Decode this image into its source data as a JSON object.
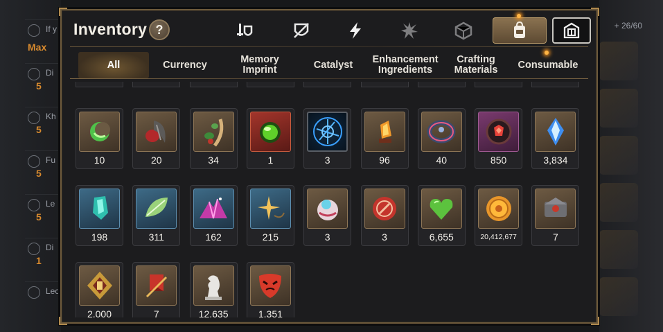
{
  "background": {
    "left_rows": [
      {
        "name": "If y"
      },
      {
        "name": "Di",
        "level": "5"
      },
      {
        "name": "Kh",
        "level": "5"
      },
      {
        "name": "Fu",
        "level": "5"
      },
      {
        "name": "Le",
        "level": "5"
      },
      {
        "name": "Di",
        "level": "1"
      },
      {
        "name": "Leo"
      }
    ],
    "max_label": "Max",
    "right_count": "+ 26/60"
  },
  "panel": {
    "title": "Inventory",
    "help_label": "?",
    "category_icons": [
      {
        "name": "equipment-icon",
        "active": false
      },
      {
        "name": "broken-shield-icon",
        "active": false
      },
      {
        "name": "lightning-icon",
        "active": false
      },
      {
        "name": "burst-icon",
        "active": false
      },
      {
        "name": "cube-icon",
        "active": false
      },
      {
        "name": "backpack-icon",
        "active": true
      },
      {
        "name": "storage-icon",
        "active": false
      }
    ],
    "tabs": [
      {
        "label": "All",
        "active": true
      },
      {
        "label": "Currency",
        "active": false
      },
      {
        "label": "Memory Imprint",
        "active": false
      },
      {
        "label": "Catalyst",
        "active": false
      },
      {
        "label": "Enhancement Ingredients",
        "active": false
      },
      {
        "label": "Crafting Materials",
        "active": false
      },
      {
        "label": "Consumable",
        "active": false
      }
    ],
    "items": [
      {
        "icon": "green-crescent-icon",
        "rarity": "brown",
        "qty": "10"
      },
      {
        "icon": "red-claw-icon",
        "rarity": "brown",
        "qty": "20"
      },
      {
        "icon": "leaf-sprig-icon",
        "rarity": "brown",
        "qty": "34"
      },
      {
        "icon": "green-orb-icon",
        "rarity": "red",
        "qty": "1"
      },
      {
        "icon": "blue-rune-icon",
        "rarity": "round",
        "qty": "3"
      },
      {
        "icon": "flame-crystal-icon",
        "rarity": "brown",
        "qty": "96"
      },
      {
        "icon": "bracelet-icon",
        "rarity": "brown",
        "qty": "40"
      },
      {
        "icon": "red-gem-icon",
        "rarity": "purple",
        "qty": "850"
      },
      {
        "icon": "blue-gem-icon",
        "rarity": "brown",
        "qty": "3,834"
      },
      {
        "icon": "cyan-crystal-icon",
        "rarity": "blue",
        "qty": "198"
      },
      {
        "icon": "green-leaf-icon",
        "rarity": "blue",
        "qty": "311"
      },
      {
        "icon": "pink-crystal-icon",
        "rarity": "blue",
        "qty": "162"
      },
      {
        "icon": "star-pendant-icon",
        "rarity": "blue",
        "qty": "215"
      },
      {
        "icon": "pink-orb-icon",
        "rarity": "brown",
        "qty": "3"
      },
      {
        "icon": "red-seal-icon",
        "rarity": "brown",
        "qty": "3"
      },
      {
        "icon": "green-heart-icon",
        "rarity": "brown",
        "qty": "6,655"
      },
      {
        "icon": "gold-coin-icon",
        "rarity": "brown",
        "qty": "20,412,677"
      },
      {
        "icon": "stone-box-icon",
        "rarity": "brown",
        "qty": "7"
      },
      {
        "icon": "gold-emblem-icon",
        "rarity": "brown",
        "qty": "2,000"
      },
      {
        "icon": "red-banner-icon",
        "rarity": "brown",
        "qty": "7"
      },
      {
        "icon": "chess-knight-icon",
        "rarity": "brown",
        "qty": "12,635"
      },
      {
        "icon": "red-mask-icon",
        "rarity": "brown",
        "qty": "1,351"
      }
    ]
  },
  "colors": {
    "accent_gold": "#b08a4e",
    "panel_bg": "#1c1c1e",
    "quantity_text": "#f2efe9",
    "level_orange": "#d88a2e"
  }
}
